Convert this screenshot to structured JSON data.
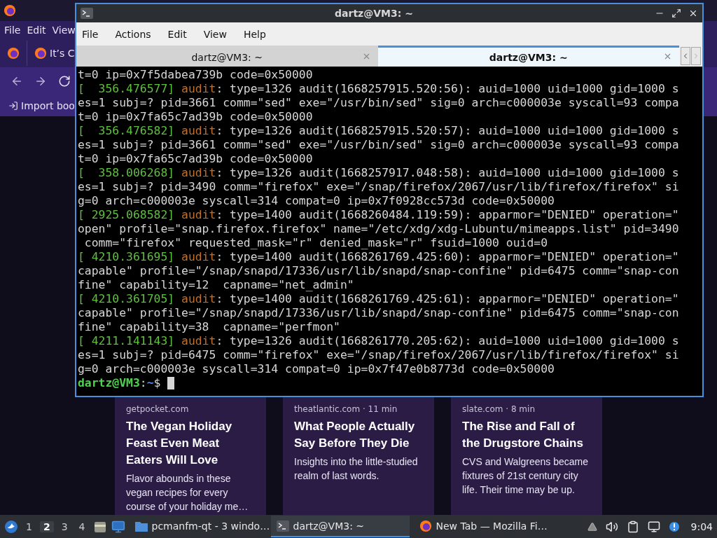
{
  "browser": {
    "menu": [
      "File",
      "Edit",
      "View"
    ],
    "tab": {
      "title": "It’s C"
    },
    "bookmark": "Import boo",
    "cards": [
      {
        "source": "getpocket.com",
        "title": "The Vegan Holiday Feast Even Meat Eaters Will Love",
        "excerpt": "Flavor abounds in these vegan recipes for every course of your holiday me…"
      },
      {
        "source": "theatlantic.com · 11 min",
        "title": "What People Actually Say Before They Die",
        "excerpt": "Insights into the little-studied realm of last words."
      },
      {
        "source": "slate.com · 8 min",
        "title": "The Rise and Fall of the Drugstore Chains",
        "excerpt": "CVS and Walgreens became fixtures of 21st century city life. Their time may be up."
      }
    ]
  },
  "terminal": {
    "title": "dartz@VM3: ~",
    "menu": [
      "File",
      "Actions",
      "Edit",
      "View",
      "Help"
    ],
    "tabs": [
      {
        "label": "dartz@VM3: ~",
        "selected": false
      },
      {
        "label": "dartz@VM3: ~",
        "selected": true
      }
    ],
    "lines": [
      {
        "kind": "plain",
        "text": "t=0 ip=0x7f5dabea739b code=0x50000"
      },
      {
        "kind": "log",
        "timestamp": "[  356.476577]",
        "source": "audit",
        "text": ": type=1326 audit(1668257915.520:56): auid=1000 uid=1000 gid=1000 s"
      },
      {
        "kind": "plain",
        "text": "es=1 subj=? pid=3661 comm=\"sed\" exe=\"/usr/bin/sed\" sig=0 arch=c000003e syscall=93 compa"
      },
      {
        "kind": "plain",
        "text": "t=0 ip=0x7fa65c7ad39b code=0x50000"
      },
      {
        "kind": "log",
        "timestamp": "[  356.476582]",
        "source": "audit",
        "text": ": type=1326 audit(1668257915.520:57): auid=1000 uid=1000 gid=1000 s"
      },
      {
        "kind": "plain",
        "text": "es=1 subj=? pid=3661 comm=\"sed\" exe=\"/usr/bin/sed\" sig=0 arch=c000003e syscall=93 compa"
      },
      {
        "kind": "plain",
        "text": "t=0 ip=0x7fa65c7ad39b code=0x50000"
      },
      {
        "kind": "log",
        "timestamp": "[  358.006268]",
        "source": "audit",
        "text": ": type=1326 audit(1668257917.048:58): auid=1000 uid=1000 gid=1000 s"
      },
      {
        "kind": "plain",
        "text": "es=1 subj=? pid=3490 comm=\"firefox\" exe=\"/snap/firefox/2067/usr/lib/firefox/firefox\" si"
      },
      {
        "kind": "plain",
        "text": "g=0 arch=c000003e syscall=314 compat=0 ip=0x7f0928cc573d code=0x50000"
      },
      {
        "kind": "log",
        "timestamp": "[ 2925.068582]",
        "source": "audit",
        "text": ": type=1400 audit(1668260484.119:59): apparmor=\"DENIED\" operation=\""
      },
      {
        "kind": "plain",
        "text": "open\" profile=\"snap.firefox.firefox\" name=\"/etc/xdg/xdg-Lubuntu/mimeapps.list\" pid=3490"
      },
      {
        "kind": "plain",
        "text": " comm=\"firefox\" requested_mask=\"r\" denied_mask=\"r\" fsuid=1000 ouid=0"
      },
      {
        "kind": "log",
        "timestamp": "[ 4210.361695]",
        "source": "audit",
        "text": ": type=1400 audit(1668261769.425:60): apparmor=\"DENIED\" operation=\""
      },
      {
        "kind": "plain",
        "text": "capable\" profile=\"/snap/snapd/17336/usr/lib/snapd/snap-confine\" pid=6475 comm=\"snap-con"
      },
      {
        "kind": "plain",
        "text": "fine\" capability=12  capname=\"net_admin\""
      },
      {
        "kind": "log",
        "timestamp": "[ 4210.361705]",
        "source": "audit",
        "text": ": type=1400 audit(1668261769.425:61): apparmor=\"DENIED\" operation=\""
      },
      {
        "kind": "plain",
        "text": "capable\" profile=\"/snap/snapd/17336/usr/lib/snapd/snap-confine\" pid=6475 comm=\"snap-con"
      },
      {
        "kind": "plain",
        "text": "fine\" capability=38  capname=\"perfmon\""
      },
      {
        "kind": "log",
        "timestamp": "[ 4211.141143]",
        "source": "audit",
        "text": ": type=1326 audit(1668261770.205:62): auid=1000 uid=1000 gid=1000 s"
      },
      {
        "kind": "plain",
        "text": "es=1 subj=? pid=6475 comm=\"firefox\" exe=\"/snap/firefox/2067/usr/lib/firefox/firefox\" si"
      },
      {
        "kind": "plain",
        "text": "g=0 arch=c000003e syscall=314 compat=0 ip=0x7f47e0b8773d code=0x50000"
      }
    ],
    "prompt": {
      "user": "dartz@VM3",
      "separator": ":",
      "path": "~",
      "symbol": "$"
    }
  },
  "taskbar": {
    "workspaces": [
      {
        "label": "1",
        "selected": false
      },
      {
        "label": "2",
        "selected": true
      },
      {
        "label": "3",
        "selected": false
      },
      {
        "label": "4",
        "selected": false
      }
    ],
    "tasks": [
      {
        "kind": "files",
        "label": "pcmanfm-qt - 3 windo…",
        "selected": false
      },
      {
        "kind": "terminal",
        "label": "dartz@VM3: ~",
        "selected": true
      },
      {
        "kind": "browser",
        "label": "New Tab — Mozilla Fi…",
        "selected": false
      }
    ],
    "clock": "9:04"
  }
}
